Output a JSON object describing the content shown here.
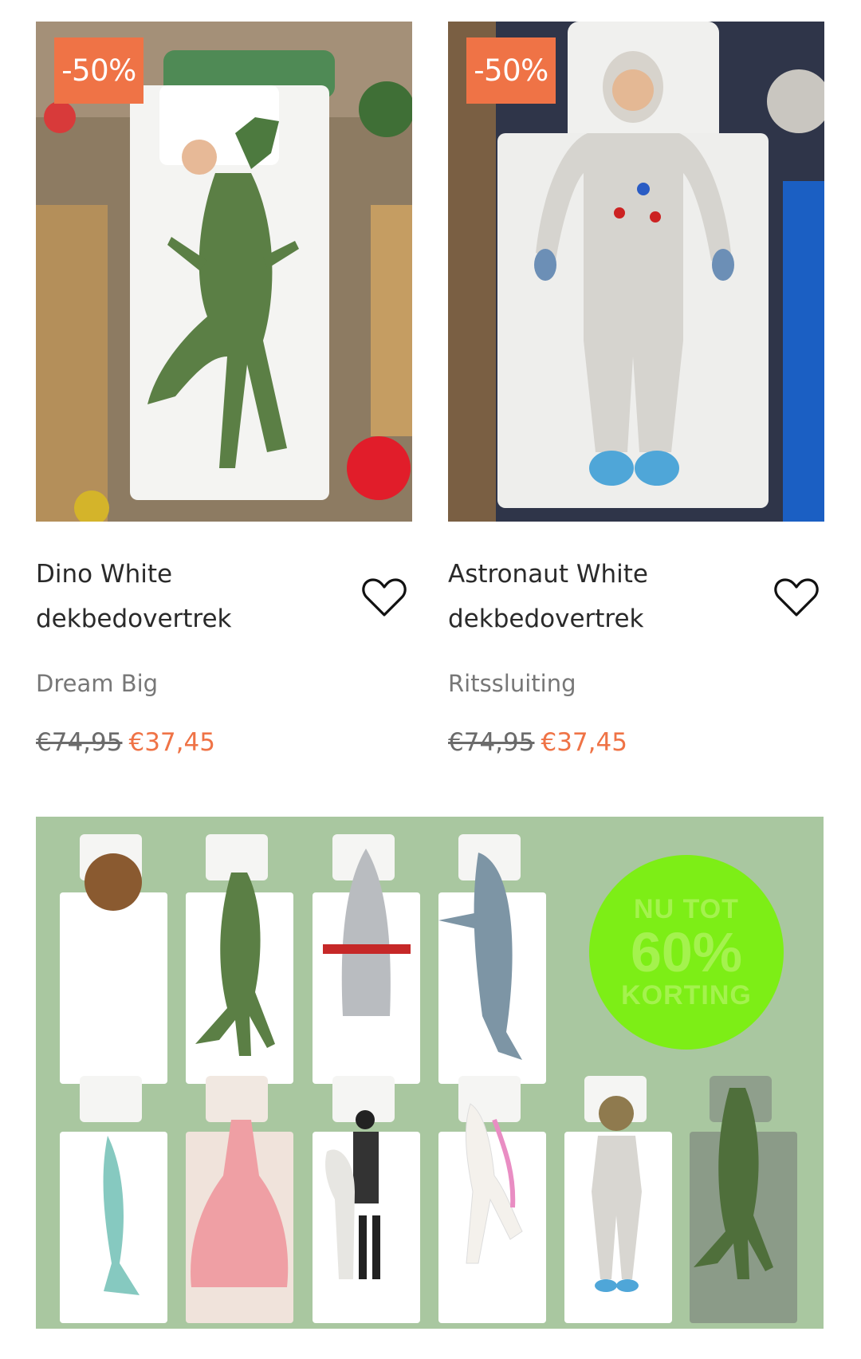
{
  "products": [
    {
      "discount_badge": "-50%",
      "title_line1": "Dino White",
      "title_line2": "dekbedovertrek",
      "subtitle": "Dream Big",
      "old_price": "€74,95",
      "new_price": "€37,45",
      "image": "dino-duvet-photo"
    },
    {
      "discount_badge": "-50%",
      "title_line1": "Astronaut White",
      "title_line2": "dekbedovertrek",
      "subtitle": "Ritssluiting",
      "old_price": "€74,95",
      "new_price": "€37,45",
      "image": "astronaut-duvet-photo"
    }
  ],
  "promo_banner": {
    "circle_line1": "NU TOT",
    "circle_line2": "60%",
    "circle_line3": "KORTING",
    "items": [
      "teddy",
      "dino",
      "rocket",
      "shark",
      "mermaid",
      "princess",
      "horse-rider",
      "unicorn",
      "astronaut",
      "dino-green"
    ]
  },
  "colors": {
    "accent": "#ef7346",
    "banner_bg": "#a9c7a0",
    "promo_circle": "#7dee16"
  },
  "icons": {
    "wishlist": "heart-outline-icon"
  }
}
